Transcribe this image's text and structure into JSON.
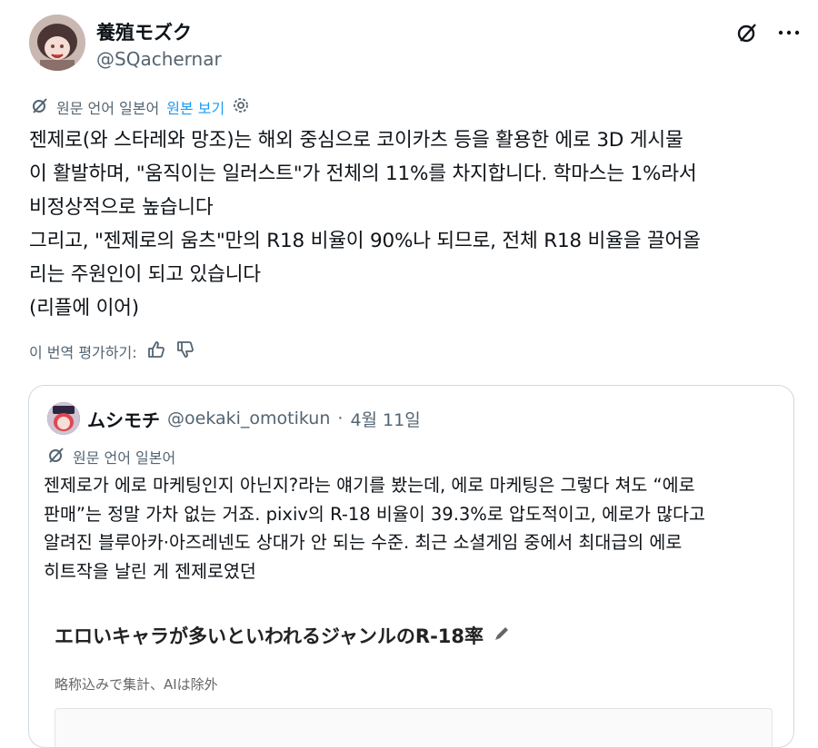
{
  "author": {
    "display_name": "養殖モズク",
    "handle": "@SQachernar"
  },
  "translation": {
    "source_language_label": "원문 언어 일본어",
    "show_original_label": "원본 보기"
  },
  "tweet": {
    "lines": [
      "젠제로(와 스타레와 망조)는 해외 중심으로 코이카츠 등을 활용한 에로 3D 게시물",
      "이 활발하며, \"움직이는 일러스트\"가 전체의 11%를 차지합니다. 학마스는 1%라서",
      "비정상적으로 높습니다",
      "그리고, \"젠제로의 움츠\"만의 R18 비율이 90%나 되므로, 전체 R18 비율을 끌어올",
      "리는 주원인이 되고 있습니다",
      "(리플에 이어)"
    ]
  },
  "rate": {
    "label": "이 번역 평가하기:"
  },
  "quote": {
    "display_name": "ムシモチ",
    "handle": "@oekaki_omotikun",
    "separator": "·",
    "date": "4월 11일",
    "source_language_label": "원문 언어 일본어",
    "lines": [
      "젠제로가 에로 마케팅인지 아닌지?라는 얘기를 봤는데, 에로 마케팅은 그렇다 쳐도 “에로",
      "판매”는 정말 가차 없는 거죠. pixiv의 R-18 비율이 39.3%로 압도적이고, 에로가 많다고",
      "알려진 블루아카·아즈레넨도 상대가 안 되는 수준. 최근 소셜게임 중에서 최대급의 에로",
      "히트작을 날린 게 젠제로였던"
    ],
    "media": {
      "title": "エロいキャラが多いといわれるジャンルのR-18率",
      "subtitle": "略称込みで集計、AIは除外",
      "first_row_label": "",
      "first_row_value": ""
    }
  },
  "colors": {
    "link": "#1d9bf0",
    "muted": "#536471",
    "text": "#0f1419",
    "border": "#cfd9de"
  },
  "icons": {
    "grok": "grok-icon",
    "more": "more-icon",
    "translate": "translate-icon",
    "settings": "gear-icon",
    "thumbs_up": "thumbs-up-icon",
    "thumbs_down": "thumbs-down-icon",
    "edit": "pencil-icon"
  }
}
